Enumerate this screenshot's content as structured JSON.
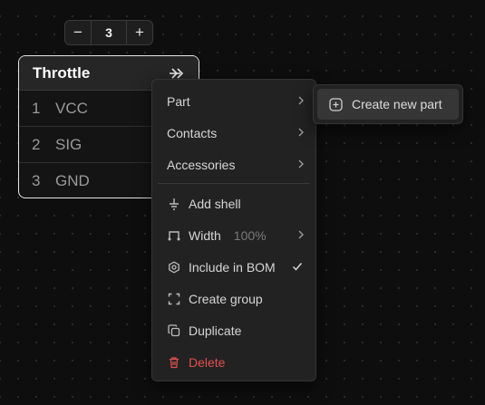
{
  "stepper": {
    "decrement": "−",
    "value": "3",
    "increment": "+"
  },
  "node": {
    "title": "Throttle",
    "pins": [
      {
        "num": "1",
        "name": "VCC"
      },
      {
        "num": "2",
        "name": "SIG"
      },
      {
        "num": "3",
        "name": "GND"
      }
    ]
  },
  "menu": {
    "part": "Part",
    "contacts": "Contacts",
    "accessories": "Accessories",
    "add_shell": "Add shell",
    "width": "Width",
    "width_value": "100%",
    "include_bom": "Include in BOM",
    "create_group": "Create group",
    "duplicate": "Duplicate",
    "delete": "Delete"
  },
  "submenu": {
    "create_new_part": "Create new part"
  },
  "colors": {
    "background": "#0e0e0e",
    "menu_bg": "#222222",
    "danger": "#e0504f",
    "node_border": "#e6e6e6"
  }
}
